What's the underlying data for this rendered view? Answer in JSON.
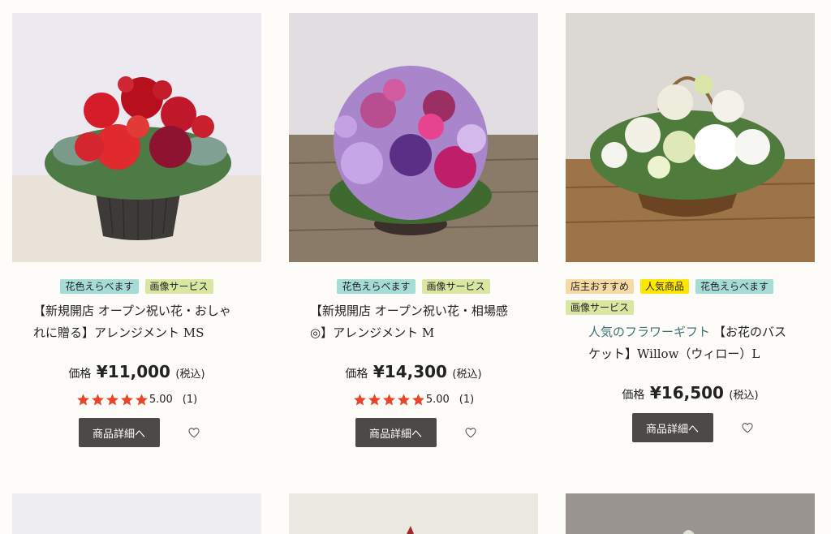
{
  "colors": {
    "teal_tag": "#a6dcd6",
    "green_tag": "#d9e7a3",
    "orange_tag": "#f7d9a4",
    "yellow_tag": "#ffe600",
    "button": "#4c4a46",
    "star": "#e8452c"
  },
  "products": [
    {
      "tags": [
        "花色えらべます",
        "画像サービス"
      ],
      "category": "",
      "title": "【新規開店 オープン祝い花・おしゃれに贈る】アレンジメント MS",
      "price_label": "価格",
      "price": "¥11,000",
      "tax": "(税込)",
      "rating": 5,
      "score": "5.00",
      "review_count": "(1)",
      "button": "商品詳細へ",
      "favorite_icon": "heart-outline-icon"
    },
    {
      "tags": [
        "花色えらべます",
        "画像サービス"
      ],
      "category": "",
      "title": "【新規開店 オープン祝い花・相場感◎】アレンジメント M",
      "price_label": "価格",
      "price": "¥14,300",
      "tax": "(税込)",
      "rating": 5,
      "score": "5.00",
      "review_count": "(1)",
      "button": "商品詳細へ",
      "favorite_icon": "heart-outline-icon"
    },
    {
      "tags": [
        "店主おすすめ",
        "人気商品",
        "花色えらべます",
        "画像サービス"
      ],
      "category": "人気のフラワーギフト",
      "title": "【お花のバスケット】Willow（ウィロー）L",
      "price_label": "価格",
      "price": "¥16,500",
      "tax": "(税込)",
      "button": "商品詳細へ",
      "favorite_icon": "heart-outline-icon"
    }
  ]
}
